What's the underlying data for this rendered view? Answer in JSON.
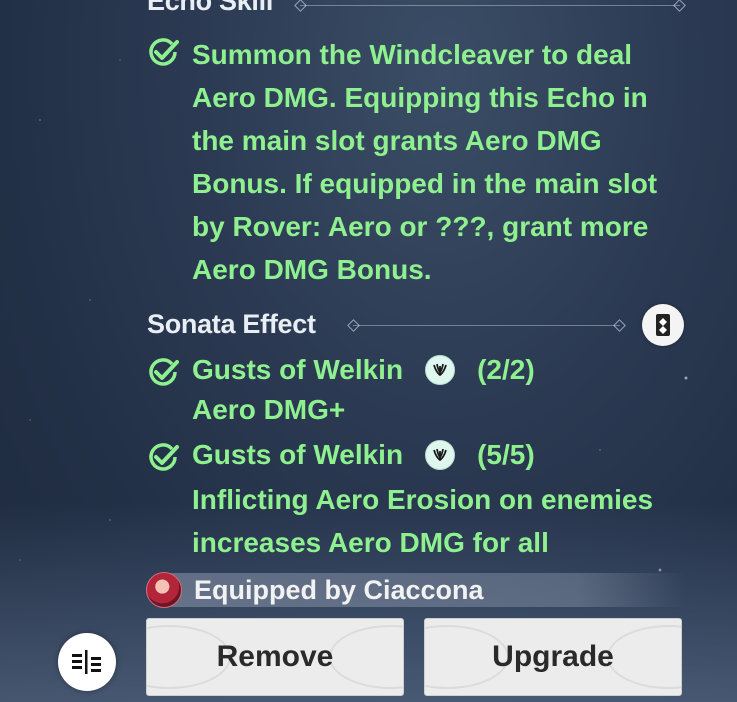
{
  "echo_skill": {
    "title": "Echo Skill",
    "description": "Summon the Windcleaver to deal Aero DMG. Equipping this Echo in the main slot grants Aero DMG Bonus. If equipped in the main slot by Rover: Aero or ???, grant more Aero DMG Bonus."
  },
  "sonata_effect": {
    "title": "Sonata Effect",
    "sets": [
      {
        "name": "Gusts of Welkin",
        "count": "(2/2)",
        "description": "Aero DMG+",
        "icon": "welkin-sonata-icon"
      },
      {
        "name": "Gusts of Welkin",
        "count": "(5/5)",
        "description": "Inflicting Aero Erosion on enemies increases Aero DMG for all",
        "icon": "welkin-sonata-icon"
      }
    ]
  },
  "equipped": {
    "label": "Equipped by Ciaccona"
  },
  "buttons": {
    "remove": "Remove",
    "upgrade": "Upgrade"
  },
  "colors": {
    "effect_text": "#8ff08f",
    "check": "#8ff08f"
  }
}
